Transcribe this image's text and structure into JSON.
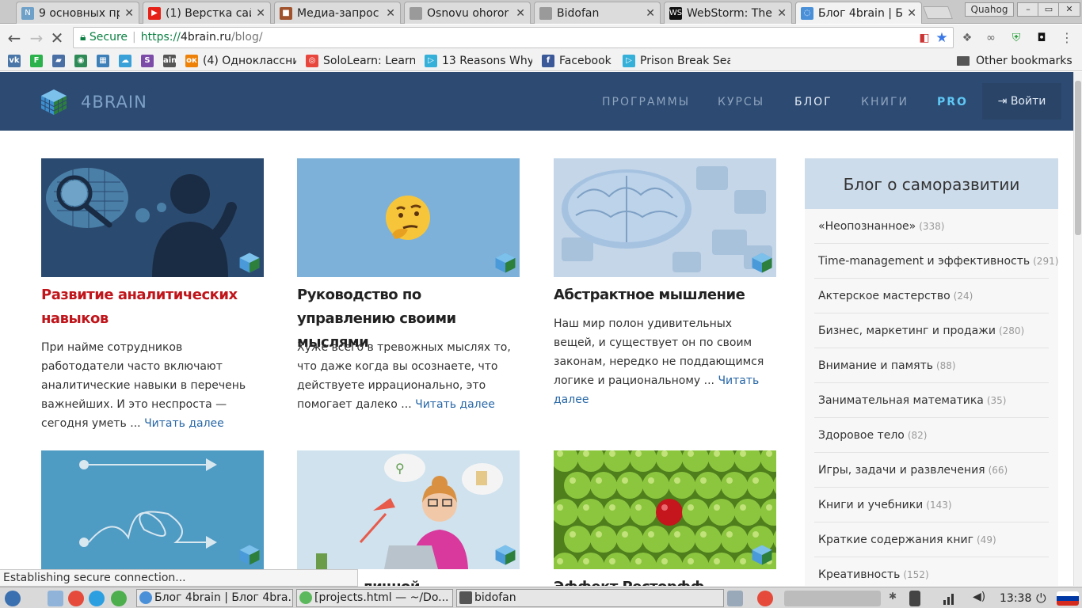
{
  "browser": {
    "tabs": [
      {
        "title": "9 основных пр",
        "fav_color": "#6ea0c8",
        "fav_letter": "N"
      },
      {
        "title": "(1) Верстка сай",
        "fav_color": "#e62117",
        "fav_letter": "▶"
      },
      {
        "title": "Медиа-запрос",
        "fav_color": "#a0522d",
        "fav_letter": "■"
      },
      {
        "title": "Osnovu ohoror",
        "fav_color": "#9a9a9a",
        "fav_letter": ""
      },
      {
        "title": "Bidofan",
        "fav_color": "#9a9a9a",
        "fav_letter": ""
      },
      {
        "title": "WebStorm: The",
        "fav_color": "#111111",
        "fav_letter": "WS"
      },
      {
        "title": "Блог 4brain | Бл",
        "fav_color": "#4a90d9",
        "fav_letter": "◌"
      }
    ],
    "profile_name": "Quahog",
    "window_buttons": [
      "–",
      "▭",
      "✕"
    ],
    "security_label": "Secure",
    "url_scheme": "https://",
    "url_host": "4brain.ru",
    "url_path": "/blog/",
    "bookmarks": [
      {
        "label": "",
        "icon": "vk-icon",
        "color": "#4a76a8",
        "glyph": "vk"
      },
      {
        "label": "",
        "icon": "feedly-icon",
        "color": "#2bb24c",
        "glyph": "F"
      },
      {
        "label": "",
        "icon": "bookmark-icon",
        "color": "#4a6fa5",
        "glyph": "▰"
      },
      {
        "label": "",
        "icon": "globe-icon",
        "color": "#2e8b57",
        "glyph": "◉"
      },
      {
        "label": "",
        "icon": "grid-icon",
        "color": "#3d7fb8",
        "glyph": "▦"
      },
      {
        "label": "",
        "icon": "cloud-icon",
        "color": "#3aa0d8",
        "glyph": "☁"
      },
      {
        "label": "",
        "icon": "s-icon",
        "color": "#7d4ca8",
        "glyph": "S"
      },
      {
        "label": "",
        "icon": "ain-icon",
        "color": "#555555",
        "glyph": "ain"
      },
      {
        "label": "(4) Одноклассни",
        "icon": "odnoklassniki-icon",
        "color": "#ee8208",
        "glyph": "ок"
      },
      {
        "label": "SoloLearn: Learn",
        "icon": "sololearn-icon",
        "color": "#e8473e",
        "glyph": "◎"
      },
      {
        "label": "13 Reasons Why",
        "icon": "play-icon",
        "color": "#35b0d8",
        "glyph": "▷"
      },
      {
        "label": "Facebook",
        "icon": "facebook-icon",
        "color": "#3b5998",
        "glyph": "f"
      },
      {
        "label": "Prison Break Sea",
        "icon": "play-icon",
        "color": "#35b0d8",
        "glyph": "▷"
      }
    ],
    "other_bookmarks": "Other bookmarks",
    "status_text": "Establishing secure connection..."
  },
  "site": {
    "logo_text": "4BRAIN",
    "nav": [
      {
        "label": "ПРОГРАММЫ"
      },
      {
        "label": "КУРСЫ"
      },
      {
        "label": "БЛОГ"
      },
      {
        "label": "КНИГИ"
      },
      {
        "label": "PRO"
      }
    ],
    "login_label": "Войти",
    "posts": [
      {
        "title": "Развитие аналитических навыков",
        "excerpt": "При найме сотрудников работодатели часто включают аналитические навыки в перечень важнейших. И это неспроста — сегодня уметь ...",
        "read_more": "Читать далее",
        "highlighted": true
      },
      {
        "title": "Руководство по управлению своими мыслями",
        "excerpt": "Хуже всего в тревожных мыслях то, что даже когда вы осознаете, что действуете иррационально, это помогает далеко ...",
        "read_more": "Читать далее",
        "highlighted": false
      },
      {
        "title": "Абстрактное мышление",
        "excerpt": "Наш мир полон удивительных вещей, и существует он по своим законам, нередко не поддающимся логике и рациональному ...",
        "read_more": "Читать далее",
        "highlighted": false
      },
      {
        "title": "",
        "excerpt": "",
        "read_more": "",
        "highlighted": false
      },
      {
        "title": "...стема личной",
        "excerpt": "",
        "read_more": "",
        "highlighted": false
      },
      {
        "title": "Эффект Ресторфф",
        "excerpt": "",
        "read_more": "",
        "highlighted": false
      }
    ],
    "sidebar": {
      "title": "Блог о саморазвитии",
      "categories": [
        {
          "name": "«Неопознанное»",
          "count": "(338)"
        },
        {
          "name": "Time-management и эффективность",
          "count": "(291)"
        },
        {
          "name": "Актерское мастерство",
          "count": "(24)"
        },
        {
          "name": "Бизнес, маркетинг и продажи",
          "count": "(280)"
        },
        {
          "name": "Внимание и память",
          "count": "(88)"
        },
        {
          "name": "Занимательная математика",
          "count": "(35)"
        },
        {
          "name": "Здоровое тело",
          "count": "(82)"
        },
        {
          "name": "Игры, задачи и развлечения",
          "count": "(66)"
        },
        {
          "name": "Книги и учебники",
          "count": "(143)"
        },
        {
          "name": "Краткие содержания книг",
          "count": "(49)"
        },
        {
          "name": "Креативность",
          "count": "(152)"
        }
      ]
    }
  },
  "taskbar": {
    "windows": [
      {
        "title": "Блог 4brain | Блог 4bra...",
        "icon_color": "#4a90d9"
      },
      {
        "title": "[projects.html — ~/Do...",
        "icon_color": "#5cb85c"
      },
      {
        "title": "bidofan",
        "icon_color": "#555555"
      }
    ],
    "clock": "13:38"
  },
  "colors": {
    "header_bg": "#2c4a72",
    "accent_red": "#c0151b",
    "link_blue": "#2767a7",
    "pro_blue": "#5fc8f5",
    "sidebar_head": "#cddceb"
  }
}
